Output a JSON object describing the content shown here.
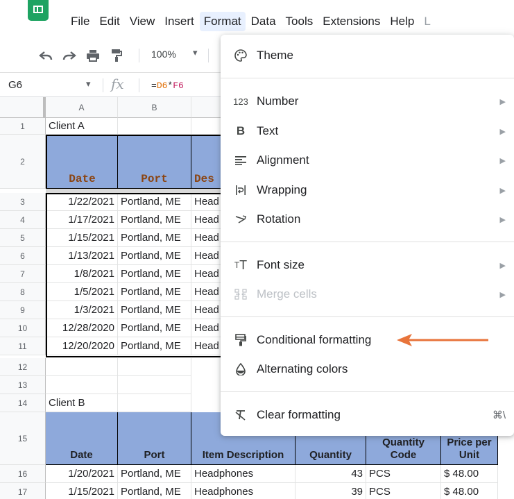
{
  "menubar": {
    "items": [
      "File",
      "Edit",
      "View",
      "Insert",
      "Format",
      "Data",
      "Tools",
      "Extensions",
      "Help",
      "L"
    ],
    "active": "Format"
  },
  "toolbar": {
    "zoom": "100%",
    "icons": [
      "undo-icon",
      "redo-icon",
      "print-icon",
      "paint-format-icon"
    ]
  },
  "formula_bar": {
    "name_box": "G6",
    "fx_label": "fx",
    "formula_prefix": "=",
    "formula_ref1": "D6",
    "formula_op": "*",
    "formula_ref2": "F6"
  },
  "grid": {
    "columns": [
      "A",
      "B"
    ],
    "rows": [
      "1",
      "2",
      "3",
      "4",
      "5",
      "6",
      "7",
      "8",
      "9",
      "10",
      "11",
      "12",
      "13",
      "14",
      "15",
      "16",
      "17"
    ],
    "client_a_label": "Client A",
    "client_b_label": "Client B",
    "table_a_headers": {
      "date": "Date",
      "port": "Port",
      "desc": "Des"
    },
    "table_a_rows": [
      {
        "date": "1/22/2021",
        "port": "Portland, ME",
        "desc": "Head"
      },
      {
        "date": "1/17/2021",
        "port": "Portland, ME",
        "desc": "Head"
      },
      {
        "date": "1/15/2021",
        "port": "Portland, ME",
        "desc": "Head"
      },
      {
        "date": "1/13/2021",
        "port": "Portland, ME",
        "desc": "Head"
      },
      {
        "date": "1/8/2021",
        "port": "Portland, ME",
        "desc": "Head"
      },
      {
        "date": "1/5/2021",
        "port": "Portland, ME",
        "desc": "Head"
      },
      {
        "date": "1/3/2021",
        "port": "Portland, ME",
        "desc": "Head"
      },
      {
        "date": "12/28/2020",
        "port": "Portland, ME",
        "desc": "Head"
      },
      {
        "date": "12/20/2020",
        "port": "Portland, ME",
        "desc": "Head"
      }
    ],
    "table_b_headers": {
      "date": "Date",
      "port": "Port",
      "desc": "Item Description",
      "qty": "Quantity",
      "qty_code": "Quantity Code",
      "price": "Price per Unit"
    },
    "table_b_rows": [
      {
        "date": "1/20/2021",
        "port": "Portland, ME",
        "desc": "Headphones",
        "qty": "43",
        "code": "PCS",
        "price": "$ 48.00"
      },
      {
        "date": "1/15/2021",
        "port": "Portland, ME",
        "desc": "Headphones",
        "qty": "39",
        "code": "PCS",
        "price": "$ 48.00"
      }
    ]
  },
  "format_menu": {
    "items": [
      {
        "label": "Theme",
        "icon": "palette-icon",
        "glyph": "🎨︎",
        "submenu": false
      },
      {
        "label": "Number",
        "icon": "number-format-icon",
        "glyph": "123",
        "submenu": true
      },
      {
        "label": "Text",
        "icon": "bold-text-icon",
        "glyph": "B",
        "submenu": true
      },
      {
        "label": "Alignment",
        "icon": "align-icon",
        "glyph": "≡",
        "submenu": true
      },
      {
        "label": "Wrapping",
        "icon": "text-wrap-icon",
        "glyph": "|⇥|",
        "submenu": true
      },
      {
        "label": "Rotation",
        "icon": "text-rotation-icon",
        "glyph": "⤴",
        "submenu": true
      },
      {
        "label": "Font size",
        "icon": "font-size-icon",
        "glyph": "тT",
        "submenu": true
      },
      {
        "label": "Merge cells",
        "icon": "merge-cells-icon",
        "glyph": "⇥⇤",
        "submenu": true,
        "disabled": true
      },
      {
        "label": "Conditional formatting",
        "icon": "conditional-formatting-icon",
        "glyph": "▤",
        "submenu": false
      },
      {
        "label": "Alternating colors",
        "icon": "alternating-colors-icon",
        "glyph": "◓",
        "submenu": false
      },
      {
        "label": "Clear formatting",
        "icon": "clear-formatting-icon",
        "glyph": "Ⱦ",
        "submenu": false,
        "shortcut": "⌘\\"
      }
    ]
  },
  "colors": {
    "header_fill": "#8ea9db",
    "callout_arrow": "#e8743b",
    "menu_active_bg": "#e8f0fe",
    "sheets_green": "#1ea362"
  }
}
